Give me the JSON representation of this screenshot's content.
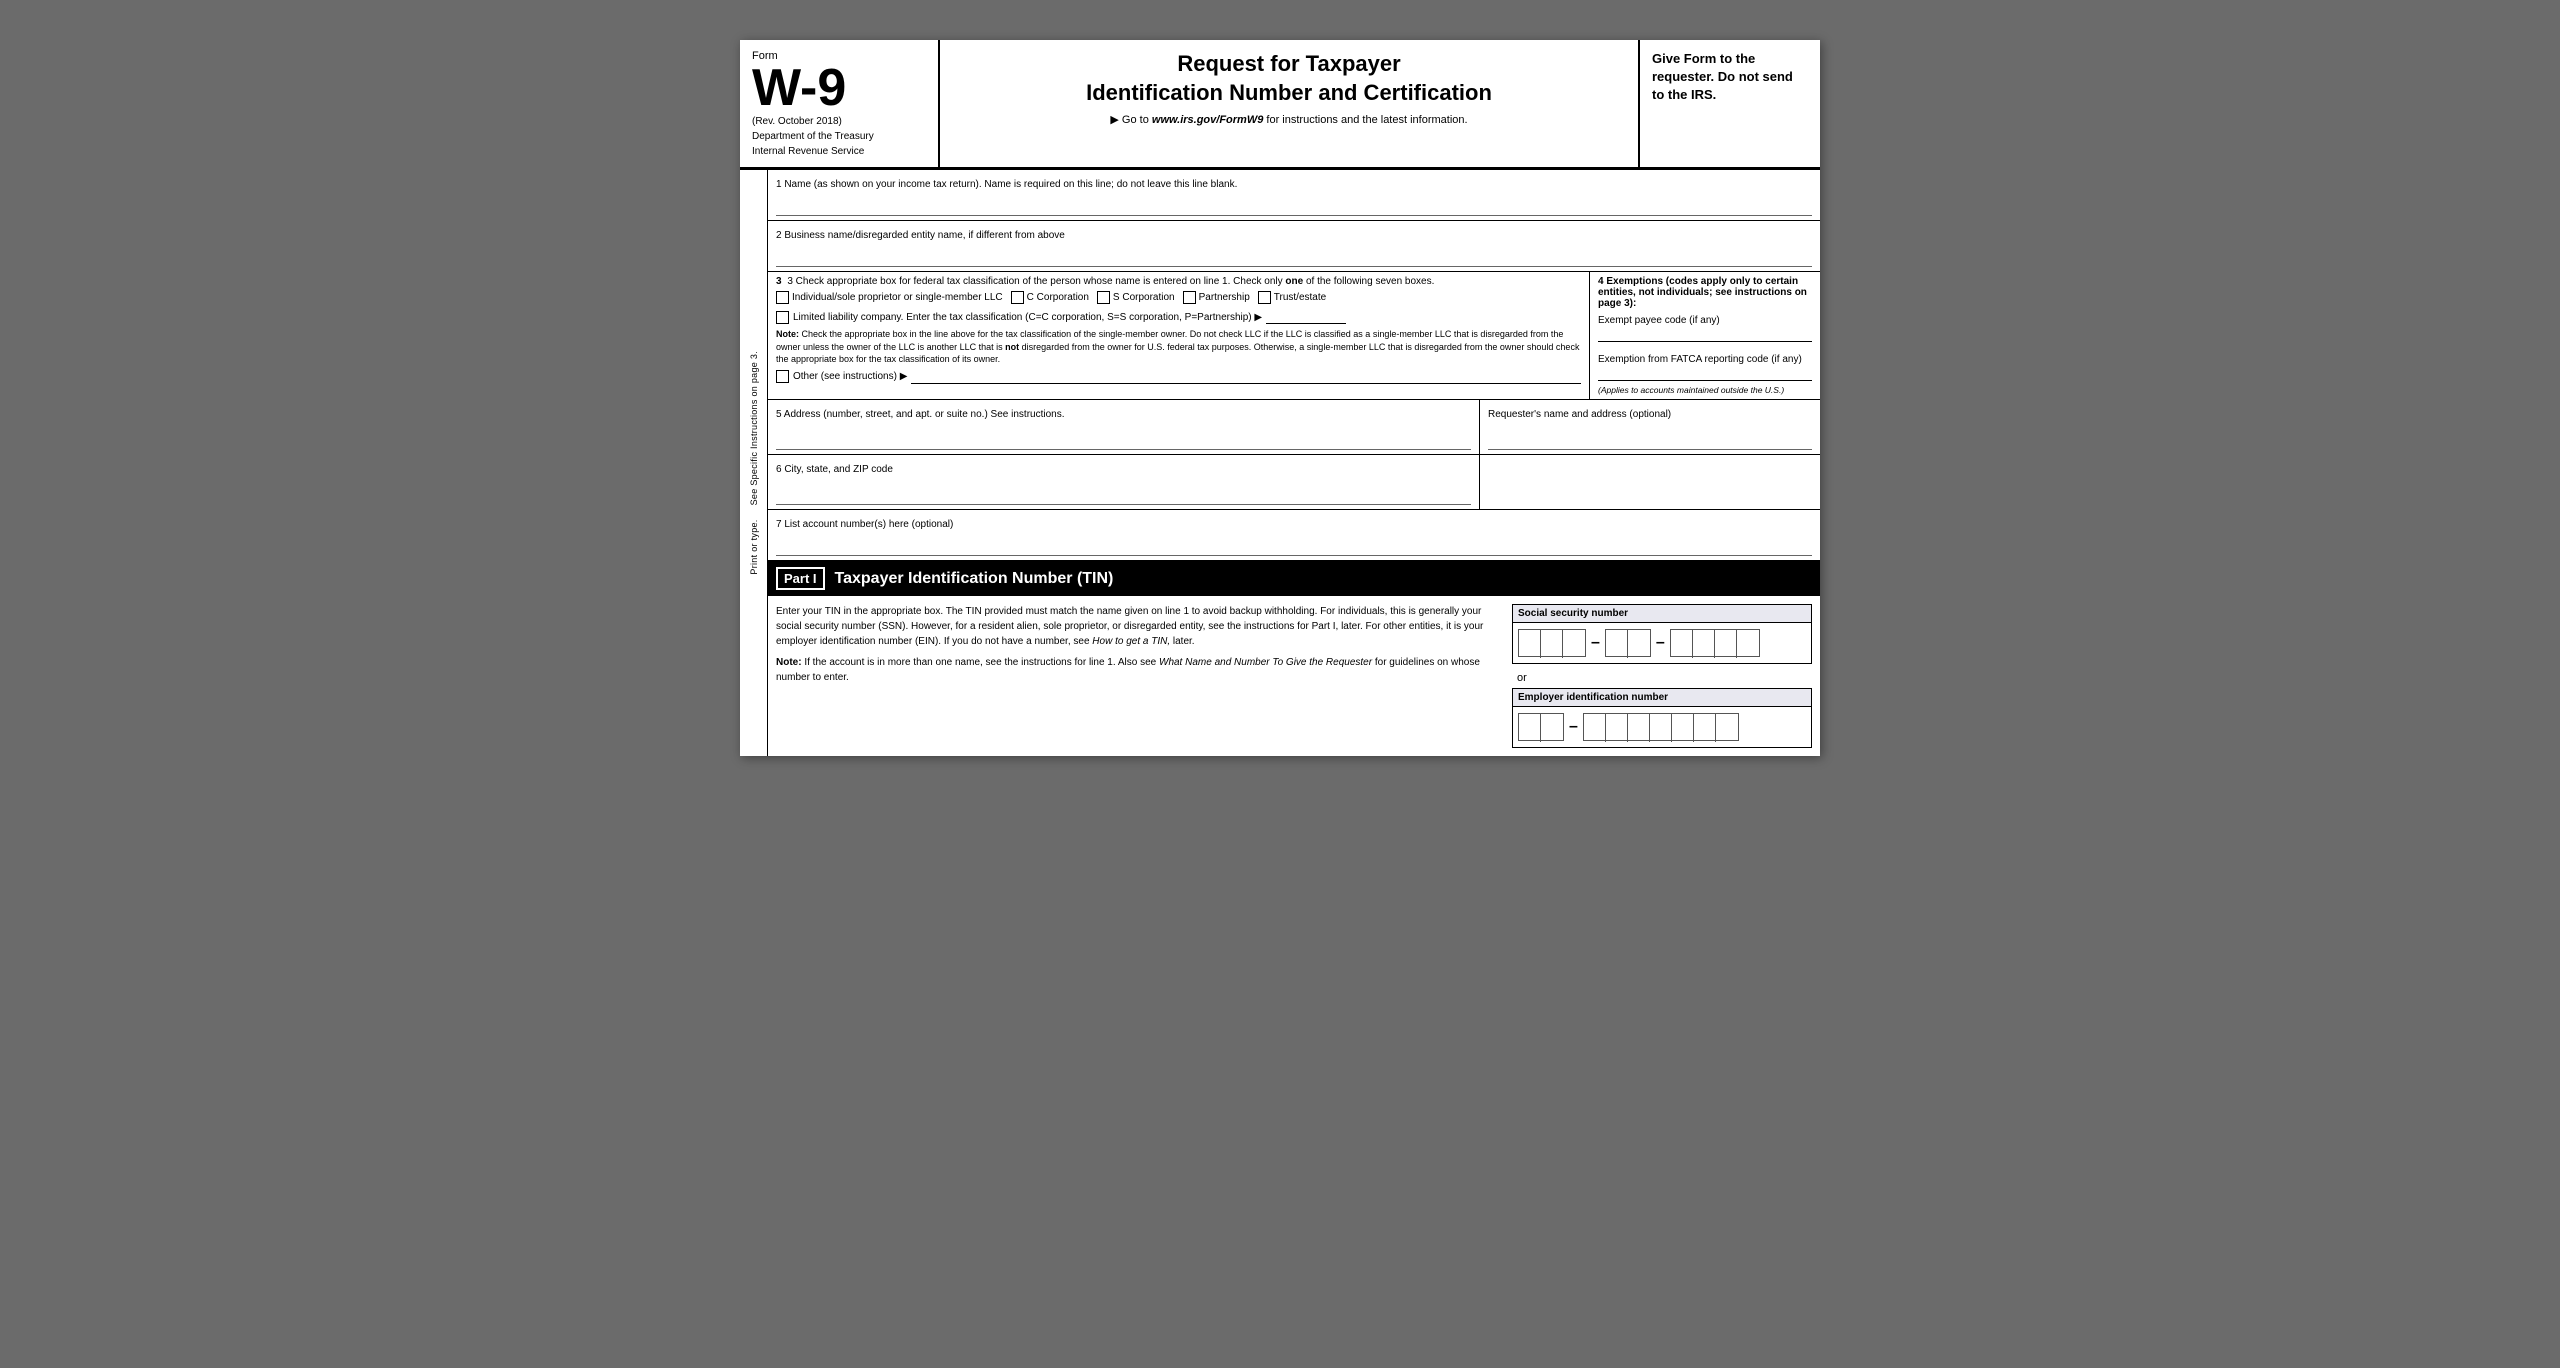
{
  "header": {
    "form_label": "Form",
    "form_number": "W-9",
    "rev_date": "(Rev. October 2018)",
    "dept": "Department of the Treasury",
    "irs": "Internal Revenue Service",
    "title_line1": "Request for Taxpayer",
    "title_line2": "Identification Number and Certification",
    "goto": "▶ Go to",
    "goto_url": "www.irs.gov/FormW9",
    "goto_suffix": "for instructions and the latest information.",
    "right_text": "Give Form to the requester. Do not send to the IRS."
  },
  "side_label": {
    "text": "Print or type.    See Specific Instructions on page 3."
  },
  "fields": {
    "field1_label": "1  Name (as shown on your income tax return). Name is required on this line; do not leave this line blank.",
    "field2_label": "2  Business name/disregarded entity name, if different from above",
    "field3_label": "3  Check appropriate box for federal tax classification of the person whose name is entered on line 1. Check only",
    "field3_label_bold": "one",
    "field3_label_end": "of the following seven boxes.",
    "checkbox1_label": "Individual/sole proprietor or single-member LLC",
    "checkbox2_label": "C Corporation",
    "checkbox3_label": "S Corporation",
    "checkbox4_label": "Partnership",
    "checkbox5_label": "Trust/estate",
    "llc_label": "Limited liability company. Enter the tax classification (C=C corporation, S=S corporation, P=Partnership) ▶",
    "note_label": "Note:",
    "note_text": "Check the appropriate box in the line above for the tax classification of the single-member owner.  Do not check LLC if the LLC is classified as a single-member LLC that is disregarded from the owner unless the owner of the LLC is another LLC that is",
    "note_bold": "not",
    "note_text2": "disregarded from the owner for U.S. federal tax purposes. Otherwise, a single-member LLC that is disregarded from the owner should check the appropriate box for the tax classification of its owner.",
    "other_label": "Other (see instructions) ▶",
    "exemptions_heading": "4  Exemptions (codes apply only to certain entities, not individuals; see instructions on page 3):",
    "exempt_payee_label": "Exempt payee code (if any)",
    "fatca_label": "Exemption from FATCA reporting code (if any)",
    "fatca_note": "(Applies to accounts maintained outside the U.S.)",
    "field5_label": "5  Address (number, street, and apt. or suite no.) See instructions.",
    "requester_label": "Requester's name and address (optional)",
    "field6_label": "6  City, state, and ZIP code",
    "field7_label": "7  List account number(s) here (optional)"
  },
  "part1": {
    "badge": "Part I",
    "title": "Taxpayer Identification Number (TIN)",
    "body_p1": "Enter your TIN in the appropriate box. The TIN provided must match the name given on line 1 to avoid backup withholding. For individuals, this is generally your social security number (SSN). However, for a resident alien, sole proprietor, or disregarded entity, see the instructions for Part I, later. For other entities, it is your employer identification number (EIN). If you do not have a number, see",
    "body_p1_italic": "How to get a TIN,",
    "body_p1_end": "later.",
    "body_p2_start": "Note:",
    "body_p2": "If the account is in more than one name, see the instructions for line 1. Also see",
    "body_p2_italic": "What Name and Number To Give the Requester",
    "body_p2_end": "for guidelines on whose number to enter.",
    "ssn_label": "Social security number",
    "or_text": "or",
    "ein_label": "Employer identification number"
  }
}
